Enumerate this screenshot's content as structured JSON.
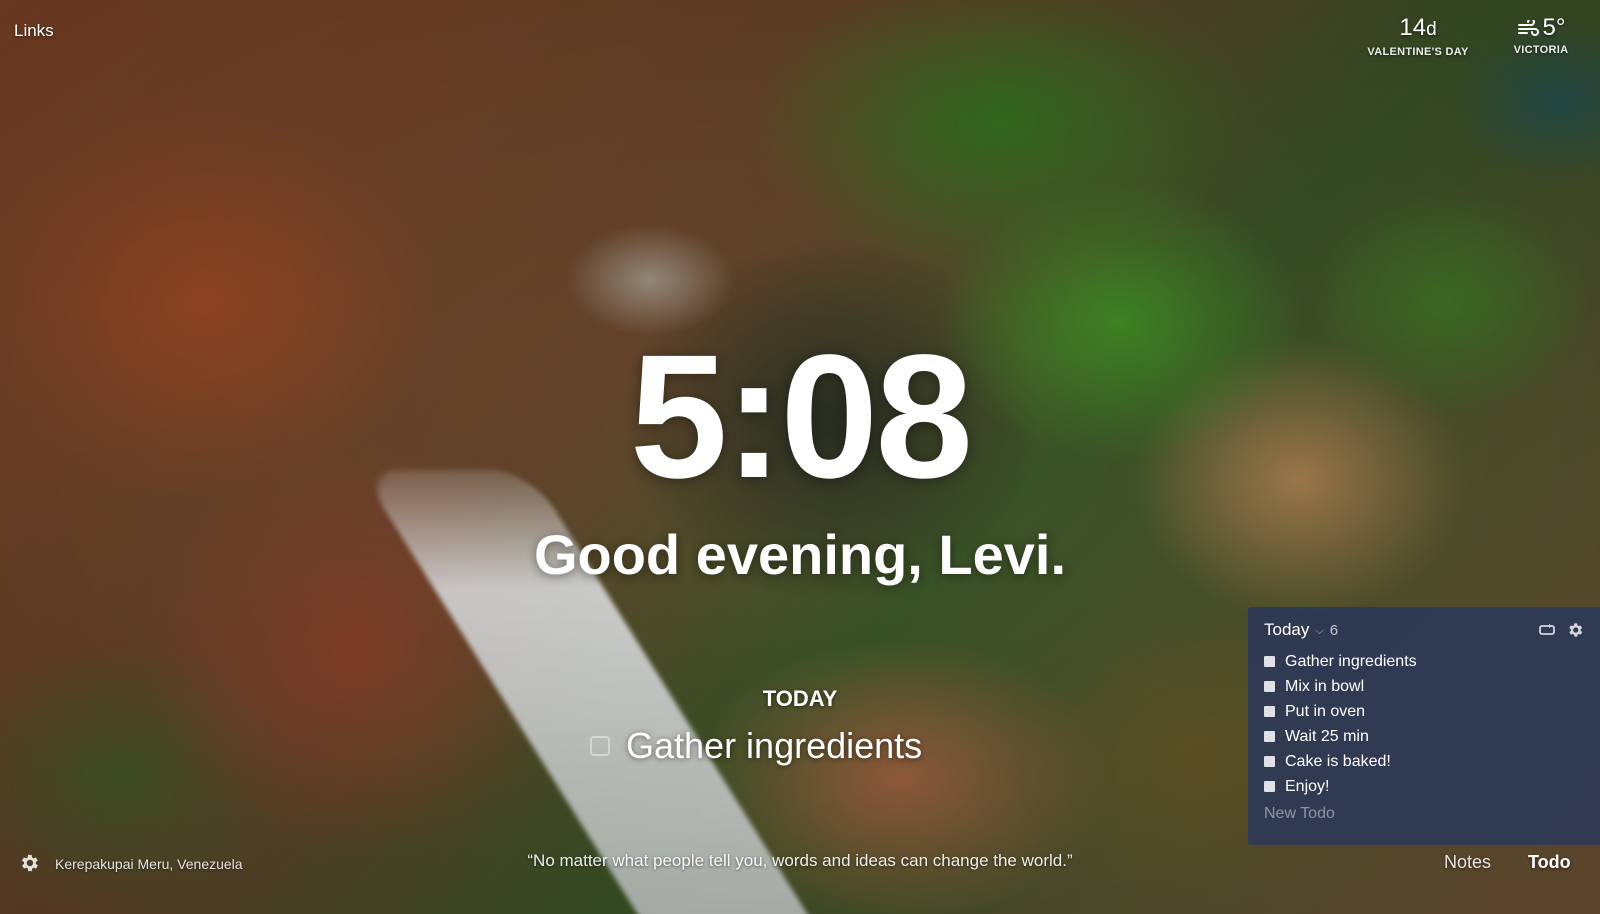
{
  "top_left": {
    "links_label": "Links"
  },
  "countdown": {
    "value": "14",
    "unit": "d",
    "caption": "VALENTINE'S DAY"
  },
  "weather": {
    "temperature": "5°",
    "location": "VICTORIA",
    "icon": "wind-icon"
  },
  "clock": {
    "time": "5:08"
  },
  "greeting": {
    "text": "Good evening, Levi."
  },
  "focus": {
    "label": "TODAY",
    "task": "Gather ingredients"
  },
  "footer": {
    "photo_location": "Kerepakupai Meru, Venezuela",
    "quote": "“No matter what people tell you, words and ideas can change the world.”",
    "notes_label": "Notes",
    "todo_label": "Todo"
  },
  "todo_panel": {
    "list_name": "Today",
    "count": "6",
    "items": [
      {
        "label": "Gather ingredients"
      },
      {
        "label": "Mix in bowl"
      },
      {
        "label": "Put in oven"
      },
      {
        "label": "Wait 25 min"
      },
      {
        "label": "Cake is baked!"
      },
      {
        "label": "Enjoy!"
      }
    ],
    "new_todo_placeholder": "New Todo"
  }
}
